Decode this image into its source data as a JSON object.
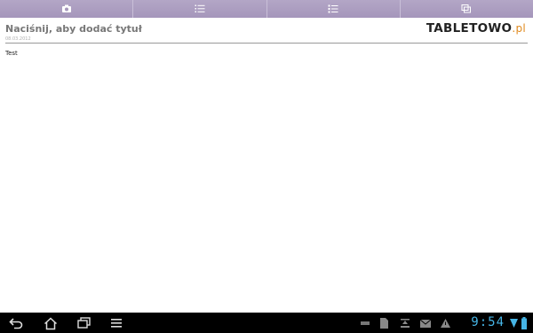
{
  "toolbar": {
    "buttons": [
      {
        "name": "camera-icon"
      },
      {
        "name": "numbered-list-icon"
      },
      {
        "name": "bullet-list-icon"
      },
      {
        "name": "copy-pages-icon"
      }
    ]
  },
  "note": {
    "title": "Naciśnij, aby dodać tytuł",
    "date": "08.03.2012",
    "body": "Test"
  },
  "brand": {
    "main": "TABLETOWO",
    "suffix": ".pl"
  },
  "statusbar": {
    "time": "9:54"
  },
  "colors": {
    "toolbar": "#a596bb",
    "accent_time": "#46b5e6",
    "brand_suffix": "#e08a1e"
  }
}
